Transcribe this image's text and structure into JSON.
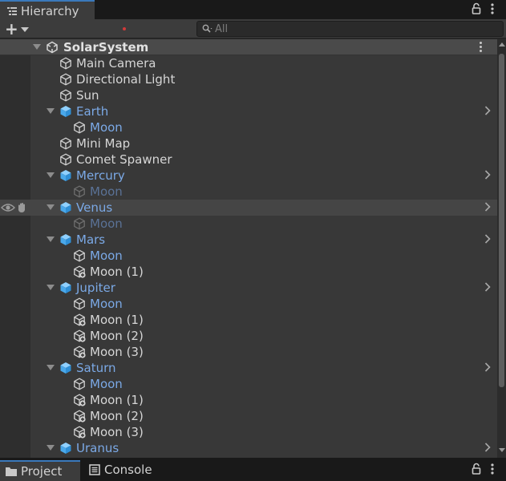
{
  "window": {
    "tab_title": "Hierarchy",
    "lock_icon": "lock-icon",
    "menu_icon": "kebab-menu-icon"
  },
  "toolbar": {
    "add_label": "+",
    "search_placeholder": "All"
  },
  "scene": {
    "name": "SolarSystem"
  },
  "rows": [
    {
      "label": "Main Camera",
      "depth": 1,
      "type": "object",
      "color": "white"
    },
    {
      "label": "Directional Light",
      "depth": 1,
      "type": "object",
      "color": "white"
    },
    {
      "label": "Sun",
      "depth": 1,
      "type": "object",
      "color": "white"
    },
    {
      "label": "Earth",
      "depth": 1,
      "type": "prefab",
      "color": "blue",
      "fold": true,
      "chevron": true
    },
    {
      "label": "Moon",
      "depth": 2,
      "type": "object",
      "color": "blue"
    },
    {
      "label": "Mini Map",
      "depth": 1,
      "type": "object",
      "color": "white"
    },
    {
      "label": "Comet Spawner",
      "depth": 1,
      "type": "object",
      "color": "white"
    },
    {
      "label": "Mercury",
      "depth": 1,
      "type": "prefab",
      "color": "blue",
      "fold": true,
      "chevron": true
    },
    {
      "label": "Moon",
      "depth": 2,
      "type": "object",
      "color": "dim"
    },
    {
      "label": "Venus",
      "depth": 1,
      "type": "prefab",
      "color": "blue",
      "fold": true,
      "chevron": true,
      "highlight": true
    },
    {
      "label": "Moon",
      "depth": 2,
      "type": "object",
      "color": "dim"
    },
    {
      "label": "Mars",
      "depth": 1,
      "type": "prefab",
      "color": "blue",
      "fold": true,
      "chevron": true
    },
    {
      "label": "Moon",
      "depth": 2,
      "type": "object",
      "color": "blue"
    },
    {
      "label": "Moon (1)",
      "depth": 2,
      "type": "added",
      "color": "white"
    },
    {
      "label": "Jupiter",
      "depth": 1,
      "type": "prefab",
      "color": "blue",
      "fold": true,
      "chevron": true
    },
    {
      "label": "Moon",
      "depth": 2,
      "type": "object",
      "color": "blue"
    },
    {
      "label": "Moon (1)",
      "depth": 2,
      "type": "added",
      "color": "white"
    },
    {
      "label": "Moon (2)",
      "depth": 2,
      "type": "added",
      "color": "white"
    },
    {
      "label": "Moon (3)",
      "depth": 2,
      "type": "added",
      "color": "white"
    },
    {
      "label": "Saturn",
      "depth": 1,
      "type": "prefab",
      "color": "blue",
      "fold": true,
      "chevron": true
    },
    {
      "label": "Moon",
      "depth": 2,
      "type": "object",
      "color": "blue"
    },
    {
      "label": "Moon (1)",
      "depth": 2,
      "type": "added",
      "color": "white"
    },
    {
      "label": "Moon (2)",
      "depth": 2,
      "type": "added",
      "color": "white"
    },
    {
      "label": "Moon (3)",
      "depth": 2,
      "type": "added",
      "color": "white"
    },
    {
      "label": "Uranus",
      "depth": 1,
      "type": "prefab",
      "color": "blue",
      "fold": true,
      "chevron": true
    }
  ],
  "bottom_tabs": [
    {
      "label": "Project",
      "icon": "folder-icon",
      "active": true
    },
    {
      "label": "Console",
      "icon": "console-icon",
      "active": false
    }
  ],
  "colors": {
    "accent": "#3a79bb",
    "prefab_blue": "#7ba9e6",
    "prefab_cube": "#5fb4f0"
  }
}
